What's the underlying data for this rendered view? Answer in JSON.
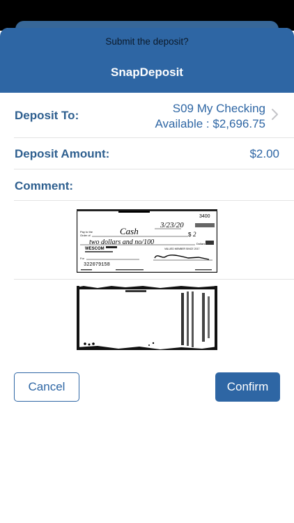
{
  "header": {
    "prompt": "Submit the deposit?",
    "title": "SnapDeposit"
  },
  "deposit_to": {
    "label": "Deposit To:",
    "account": "S09 My Checking",
    "available": "Available : $2,696.75"
  },
  "deposit_amount": {
    "label": "Deposit Amount:",
    "value": "$2.00"
  },
  "comment": {
    "label": "Comment:",
    "value": ""
  },
  "check_front": {
    "number": "3400",
    "date": "3/23/20",
    "payee": "Cash",
    "amount": "2",
    "written": "two dollars and no/100",
    "bank": "WESCOM",
    "routing": "322079158",
    "dollars": "Dollars",
    "member": "VALUED MEMBER SINCE 2017"
  },
  "actions": {
    "cancel": "Cancel",
    "confirm": "Confirm"
  },
  "colors": {
    "brand": "#2e66a4",
    "label": "#2e5f8f"
  }
}
